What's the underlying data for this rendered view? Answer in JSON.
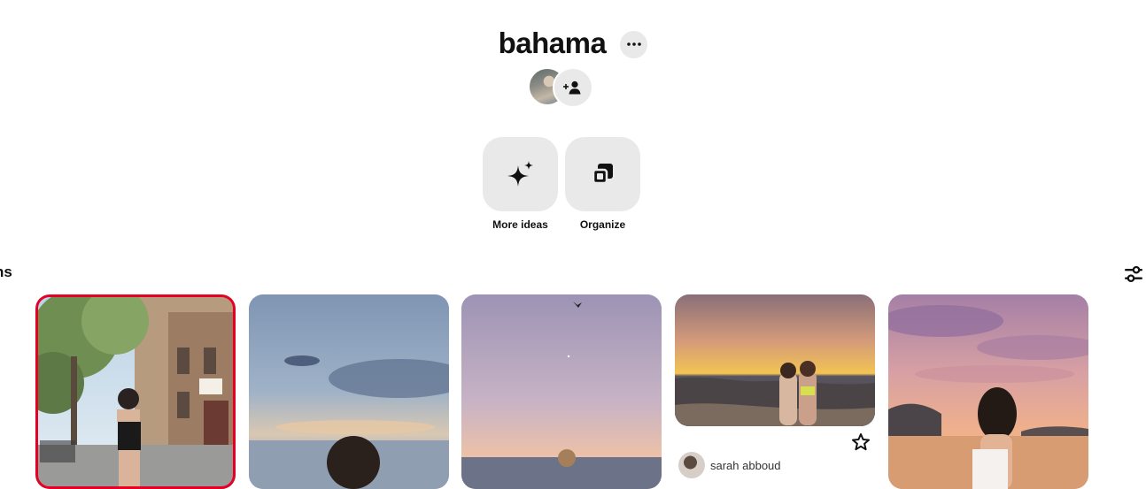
{
  "board": {
    "title": "bahama",
    "more_icon": "ellipsis-icon",
    "add_collaborator_icon": "add-person-icon"
  },
  "actions": [
    {
      "label": "More ideas",
      "icon": "sparkle-icon"
    },
    {
      "label": "Organize",
      "icon": "organize-icon"
    }
  ],
  "section": {
    "label": "ns",
    "filter_icon": "filter-sliders-icon"
  },
  "pins": [
    {
      "selected": true,
      "scene": "street"
    },
    {
      "selected": false,
      "scene": "cloudy-sea"
    },
    {
      "selected": false,
      "scene": "purple-sunset-sea"
    },
    {
      "selected": false,
      "scene": "sunset-beach-friends",
      "author": "sarah abboud",
      "save_icon": "star-icon"
    },
    {
      "selected": false,
      "scene": "pink-sky-coast"
    }
  ],
  "colors": {
    "accent_red": "#e60023",
    "button_gray": "#e9e9e9",
    "text": "#111111"
  }
}
